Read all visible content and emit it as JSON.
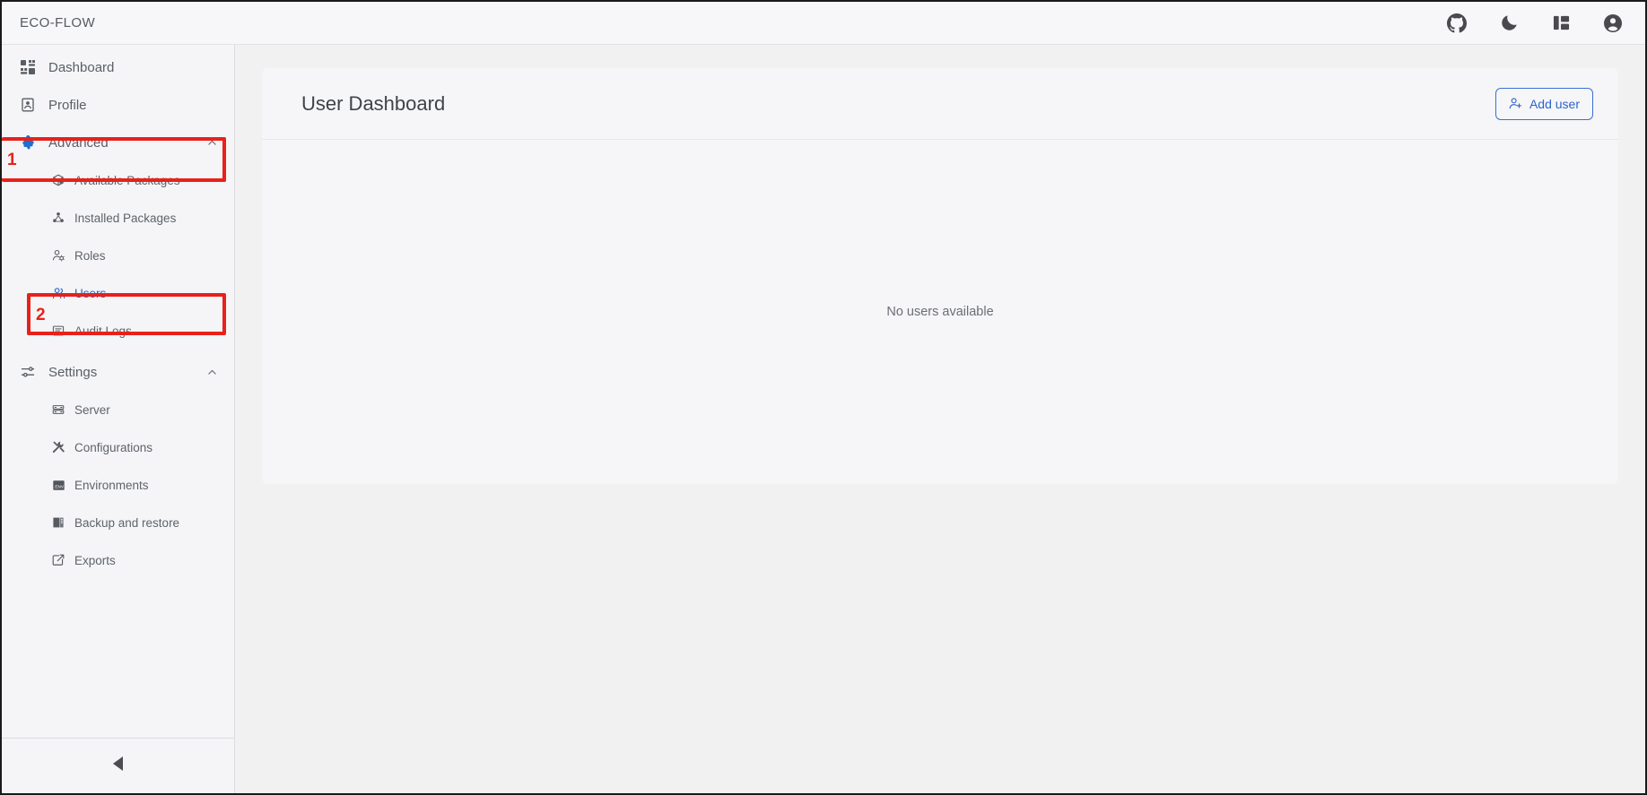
{
  "window": {
    "brand": "ECO-FLOW"
  },
  "topbar": {
    "icons": [
      {
        "name": "github-icon",
        "label": "GitHub"
      },
      {
        "name": "dark-mode-icon",
        "label": "Dark mode"
      },
      {
        "name": "layout-icon",
        "label": "Layout"
      },
      {
        "name": "account-icon",
        "label": "Account"
      }
    ]
  },
  "sidebar": {
    "items": [
      {
        "label": "Dashboard",
        "icon": "dashboard-icon"
      },
      {
        "label": "Profile",
        "icon": "profile-icon"
      },
      {
        "label": "Advanced",
        "icon": "puzzle-icon",
        "expanded": true
      },
      {
        "label": "Settings",
        "icon": "sliders-icon",
        "expanded": true
      }
    ],
    "advanced_children": [
      {
        "label": "Available Packages",
        "icon": "package-search-icon",
        "active": false
      },
      {
        "label": "Installed Packages",
        "icon": "packages-icon",
        "active": false
      },
      {
        "label": "Roles",
        "icon": "user-cog-icon",
        "active": false
      },
      {
        "label": "Users",
        "icon": "users-icon",
        "active": true
      },
      {
        "label": "Audit Logs",
        "icon": "log-icon",
        "active": false
      }
    ],
    "settings_children": [
      {
        "label": "Server",
        "icon": "server-icon",
        "active": false
      },
      {
        "label": "Configurations",
        "icon": "tools-icon",
        "active": false
      },
      {
        "label": "Environments",
        "icon": "env-file-icon",
        "active": false
      },
      {
        "label": "Backup and restore",
        "icon": "archive-icon",
        "active": false
      },
      {
        "label": "Exports",
        "icon": "export-icon",
        "active": false
      }
    ],
    "collapse_icon": "collapse-left-icon"
  },
  "main": {
    "page_title": "User Dashboard",
    "add_user_label": "Add user",
    "empty_message": "No users available"
  },
  "annotations": [
    {
      "number": "1",
      "target": "Advanced"
    },
    {
      "number": "2",
      "target": "Users"
    }
  ],
  "colors": {
    "accent": "#2563c9",
    "annotation": "#e8211b",
    "sidebar_bg": "#f5f5f7",
    "card_bg": "#f6f6f8",
    "main_bg": "#f1f1f1"
  }
}
